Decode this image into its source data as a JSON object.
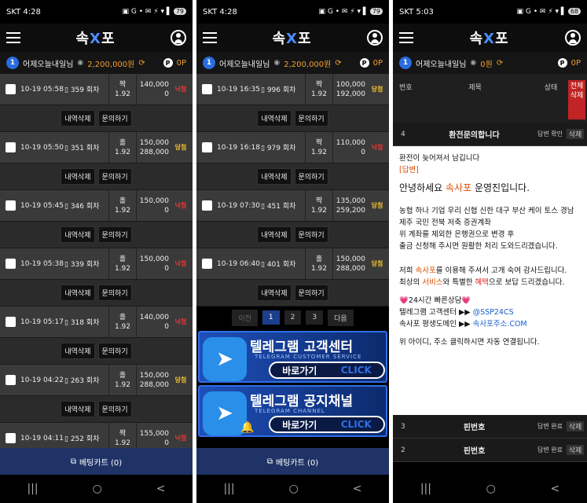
{
  "screens": [
    {
      "status": {
        "time": "SKT 4:28",
        "icons": "▣ G •   ✉ ⚡ ▾ ▌",
        "battery": "79"
      },
      "header": {
        "logo_left": "속",
        "logo_x": "X",
        "logo_right": "포"
      },
      "info": {
        "level": "1",
        "user": "어제오늘내일님",
        "money": "2,200,000원",
        "refresh": "⟳",
        "points_badge": "P",
        "points": "0P"
      },
      "rows": [
        {
          "date": "10-19 05:58",
          "round": "▯ 359 회차",
          "pick": "짝",
          "odds": "1.92",
          "bet": "140,000",
          "win": "0",
          "status": "낙첨",
          "status_type": "lose"
        },
        {
          "date": "10-19 05:50",
          "round": "▯ 351 회차",
          "pick": "홀",
          "odds": "1.92",
          "bet": "150,000",
          "win": "288,000",
          "status": "당첨",
          "status_type": "win"
        },
        {
          "date": "10-19 05:45",
          "round": "▯ 346 회차",
          "pick": "홀",
          "odds": "1.92",
          "bet": "150,000",
          "win": "0",
          "status": "낙첨",
          "status_type": "lose"
        },
        {
          "date": "10-19 05:38",
          "round": "▯ 339 회차",
          "pick": "홀",
          "odds": "1.92",
          "bet": "150,000",
          "win": "0",
          "status": "낙첨",
          "status_type": "lose"
        },
        {
          "date": "10-19 05:17",
          "round": "▯ 318 회차",
          "pick": "홀",
          "odds": "1.92",
          "bet": "140,000",
          "win": "0",
          "status": "낙첨",
          "status_type": "lose"
        },
        {
          "date": "10-19 04:22",
          "round": "▯ 263 회차",
          "pick": "홀",
          "odds": "1.92",
          "bet": "150,000",
          "win": "288,000",
          "status": "당첨",
          "status_type": "win"
        },
        {
          "date": "10-19 04:11",
          "round": "▯ 252 회차",
          "pick": "짝",
          "odds": "1.92",
          "bet": "155,000",
          "win": "0",
          "status": "낙첨",
          "status_type": "lose"
        }
      ],
      "actions": {
        "delete": "내역삭제",
        "inquiry": "문의하기"
      },
      "cart": "베팅카트 (0)"
    },
    {
      "status": {
        "time": "SKT 4:28",
        "icons": "▣ G •   ✉ ⚡ ▾ ▌",
        "battery": "79"
      },
      "header": {
        "logo_left": "속",
        "logo_x": "X",
        "logo_right": "포"
      },
      "info": {
        "level": "1",
        "user": "어제오늘내일님",
        "money": "2,200,000원",
        "refresh": "⟳",
        "points_badge": "P",
        "points": "0P"
      },
      "rows": [
        {
          "date": "10-19 16:35",
          "round": "▯ 996 회차",
          "pick": "짝",
          "odds": "1.92",
          "bet": "100,000",
          "win": "192,000",
          "status": "당첨",
          "status_type": "win"
        },
        {
          "date": "10-19 16:18",
          "round": "▯ 979 회차",
          "pick": "짝",
          "odds": "1.92",
          "bet": "110,000",
          "win": "0",
          "status": "낙첨",
          "status_type": "lose"
        },
        {
          "date": "10-19 07:30",
          "round": "▯ 451 회차",
          "pick": "짝",
          "odds": "1.92",
          "bet": "135,000",
          "win": "259,200",
          "status": "당첨",
          "status_type": "win"
        },
        {
          "date": "10-19 06:40",
          "round": "▯ 401 회차",
          "pick": "홀",
          "odds": "1.92",
          "bet": "150,000",
          "win": "288,000",
          "status": "당첨",
          "status_type": "win"
        }
      ],
      "actions": {
        "delete": "내역삭제",
        "inquiry": "문의하기"
      },
      "pager": {
        "prev": "이전",
        "p1": "1",
        "p2": "2",
        "p3": "3",
        "next": "다음"
      },
      "banners": [
        {
          "title": "텔레그램 고객센터",
          "sub": "TELEGRAM CUSTOMER SERVICE",
          "btn": "바로가기",
          "click": "CLICK"
        },
        {
          "title": "텔레그램 공지채널",
          "sub": "TELEGRAM CHANNEL",
          "btn": "바로가기",
          "click": "CLICK"
        }
      ],
      "cart": "베팅카트 (0)"
    },
    {
      "status": {
        "time": "SKT 5:03",
        "icons": "▣ G •   ✉ ⚡ ▾ ▌",
        "battery": "68"
      },
      "header": {
        "logo_left": "속",
        "logo_x": "X",
        "logo_right": "포"
      },
      "info": {
        "level": "1",
        "user": "어제오늘내일님",
        "money": "0원",
        "refresh": "⟳",
        "points_badge": "P",
        "points": "0P"
      },
      "qhead": {
        "no": "번호",
        "title": "제목",
        "state": "상태",
        "delall": "전체삭제"
      },
      "qrows": [
        {
          "no": "4",
          "title": "환전문의합니다",
          "state": "답변 확인",
          "del": "삭제"
        },
        {
          "no": "3",
          "title": "핀번호",
          "state": "답변 완료",
          "del": "삭제"
        },
        {
          "no": "2",
          "title": "핀번호",
          "state": "답변 완료",
          "del": "삭제"
        }
      ],
      "answer": {
        "q": "환전이 늦어져서 남깁니다",
        "tag": "[답변]",
        "greet_a": "안녕하세요 ",
        "greet_b": "속사포",
        "greet_c": " 운영진입니다.",
        "p1": "농협 하나 기업 우리 신협 신한 대구 부산 케이 토스 경남 제주 국민 전북 저축 증권계좌",
        "p2": "위 계좌를 제외한 은행권으로 변경 후",
        "p3": "출금 신청해 주시면 원활한 처리 도와드리겠습니다.",
        "t1a": "저희 ",
        "t1b": "속사포",
        "t1c": "를 이용해 주셔서 고개 숙여 감사드립니다.",
        "t2a": "최상의 ",
        "t2b": "서비스",
        "t2c": "와 특별한 ",
        "t2d": "혜택",
        "t2e": "으로 보답 드리겠습니다.",
        "c1": "💗24시간 빠른상담💗",
        "c2a": "텔레그램 고객센터 ▶▶ ",
        "c2b": "@SSP24CS",
        "c3a": "속사포 평생도메인 ▶▶ ",
        "c3b": "속사포주소.COM",
        "c4": "위 아이디, 주소 클릭하시면 자동 연결됩니다."
      }
    }
  ],
  "nav": {
    "recent": "|||",
    "home": "○",
    "back": "<"
  },
  "colors": {
    "accent_blue": "#1f3366",
    "win": "#f0c030",
    "lose": "#e33333",
    "money": "#f0a030"
  }
}
